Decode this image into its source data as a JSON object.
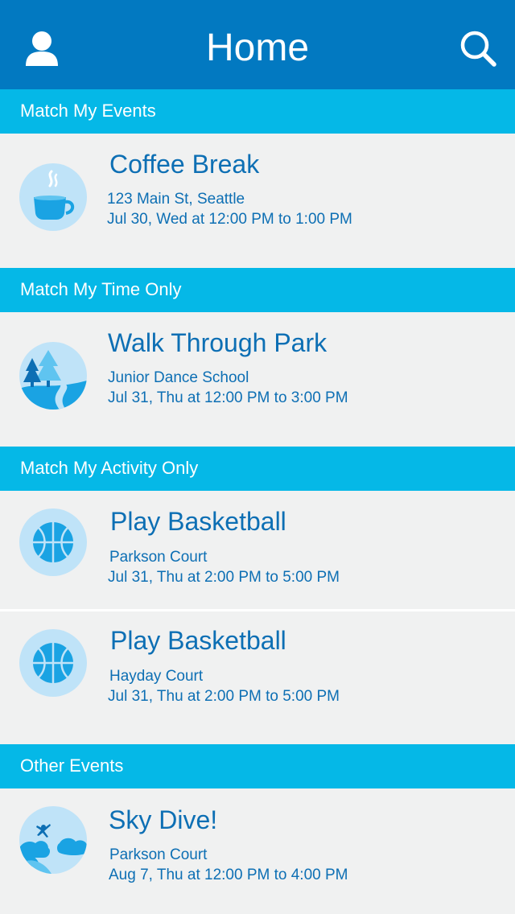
{
  "header": {
    "title": "Home",
    "profile_icon": "user-icon",
    "search_icon": "search-icon"
  },
  "sections": [
    {
      "title": "Match My Events",
      "events": [
        {
          "icon": "coffee-icon",
          "title": "Coffee Break",
          "location": "123 Main St, Seattle",
          "time": "Jul 30, Wed at 12:00 PM to 1:00 PM"
        }
      ]
    },
    {
      "title": "Match My Time Only",
      "events": [
        {
          "icon": "park-icon",
          "title": "Walk Through Park",
          "location": "Junior Dance School",
          "time": "Jul 31, Thu at 12:00 PM to 3:00 PM"
        }
      ]
    },
    {
      "title": "Match My Activity Only",
      "events": [
        {
          "icon": "basketball-icon",
          "title": "Play Basketball",
          "location": "Parkson Court",
          "time": "Jul 31, Thu at 2:00 PM to 5:00 PM"
        },
        {
          "icon": "basketball-icon",
          "title": "Play Basketball",
          "location": "Hayday Court",
          "time": "Jul 31, Thu at 2:00 PM to 5:00 PM"
        }
      ]
    },
    {
      "title": "Other Events",
      "events": [
        {
          "icon": "skydive-icon",
          "title": "Sky Dive!",
          "location": "Parkson Court",
          "time": "Aug 7, Thu at 12:00 PM to 4:00 PM"
        }
      ]
    }
  ],
  "colors": {
    "header": "#0279c1",
    "section": "#05b8e7",
    "text": "#0d6fb4",
    "card_bg": "#f0f1f1"
  }
}
